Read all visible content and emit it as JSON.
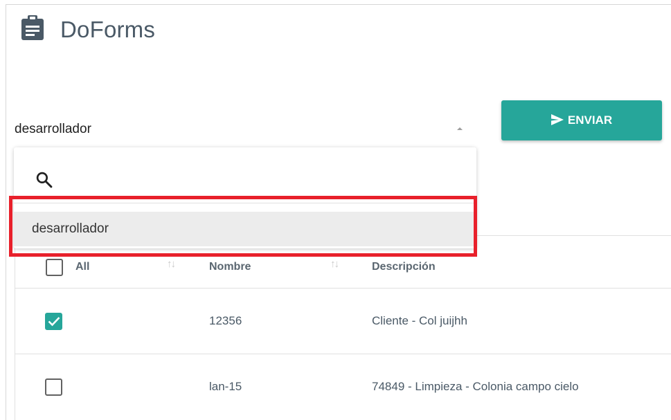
{
  "app": {
    "title": "DoForms",
    "icon": "clipboard-icon"
  },
  "role_select": {
    "value": "desarrollador",
    "search_placeholder": ""
  },
  "dropdown": {
    "options": [
      {
        "label": "desarrollador"
      }
    ]
  },
  "actions": {
    "send_label": "ENVIAR",
    "send_icon": "send-icon"
  },
  "table": {
    "select_all_label": "All",
    "columns": [
      "Nombre",
      "Descripción"
    ],
    "rows": [
      {
        "checked": true,
        "nombre": "12356",
        "descripcion": "Cliente - Col juijhh"
      },
      {
        "checked": false,
        "nombre": "lan-15",
        "descripcion": "74849 - Limpieza - Colonia campo cielo"
      }
    ]
  },
  "colors": {
    "accent": "#26a69a",
    "highlight": "#e8202b",
    "title_text": "#4a5966"
  }
}
